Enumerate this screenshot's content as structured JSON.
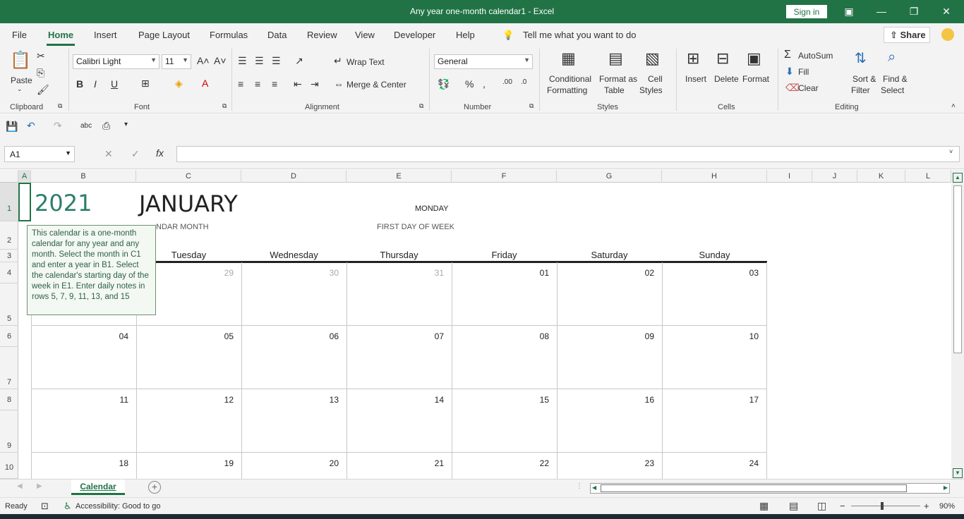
{
  "titlebar": {
    "title": "Any year one-month calendar1  -  Excel",
    "signin": "Sign in"
  },
  "menu": {
    "items": [
      "File",
      "Home",
      "Insert",
      "Page Layout",
      "Formulas",
      "Data",
      "Review",
      "View",
      "Developer",
      "Help"
    ],
    "active": "Home",
    "tell_me": "Tell me what you want to do",
    "share": "Share"
  },
  "ribbon": {
    "clipboard": {
      "paste": "Paste",
      "label": "Clipboard"
    },
    "font": {
      "name": "Calibri Light",
      "size": "11",
      "label": "Font",
      "bold": "B",
      "italic": "I",
      "underline": "U"
    },
    "alignment": {
      "wrap": "Wrap Text",
      "merge": "Merge & Center",
      "label": "Alignment"
    },
    "number": {
      "format": "General",
      "label": "Number"
    },
    "styles": {
      "conditional": [
        "Conditional",
        "Formatting"
      ],
      "format_table": [
        "Format as",
        "Table"
      ],
      "cell_styles": [
        "Cell",
        "Styles"
      ],
      "label": "Styles"
    },
    "cells": {
      "insert": "Insert",
      "delete": "Delete",
      "format": "Format",
      "label": "Cells"
    },
    "editing": {
      "autosum": "AutoSum",
      "fill": "Fill",
      "clear": "Clear",
      "sort": [
        "Sort &",
        "Filter"
      ],
      "find": [
        "Find &",
        "Select"
      ],
      "label": "Editing"
    }
  },
  "formula_bar": {
    "name_box": "A1",
    "fx": "fx",
    "value": ""
  },
  "columns": [
    "A",
    "B",
    "C",
    "D",
    "E",
    "F",
    "G",
    "H",
    "I",
    "J",
    "K",
    "L"
  ],
  "rows": [
    "1",
    "2",
    "3",
    "4",
    "5",
    "6",
    "7",
    "8",
    "9",
    "10"
  ],
  "calendar": {
    "year": "2021",
    "month": "JANUARY",
    "month_label": "NDAR MONTH",
    "first_day": "MONDAY",
    "first_day_label": "FIRST DAY OF WEEK",
    "weekdays": [
      "Tuesday",
      "Wednesday",
      "Thursday",
      "Friday",
      "Saturday",
      "Sunday"
    ],
    "weeks": [
      [
        "",
        "29",
        "30",
        "31",
        "01",
        "02",
        "03"
      ],
      [
        "04",
        "05",
        "06",
        "07",
        "08",
        "09",
        "10"
      ],
      [
        "11",
        "12",
        "13",
        "14",
        "15",
        "16",
        "17"
      ],
      [
        "18",
        "19",
        "20",
        "21",
        "22",
        "23",
        "24"
      ]
    ],
    "muted_days": [
      "29",
      "30",
      "31"
    ]
  },
  "tooltip": "This calendar is a one-month calendar for any year and any month. Select the month in C1 and enter a year in B1. Select the calendar's starting day of the week in E1. Enter daily notes in rows 5, 7, 9, 11, 13, and 15",
  "sheet_tab": "Calendar",
  "status": {
    "ready": "Ready",
    "accessibility": "Accessibility: Good to go",
    "zoom": "90%"
  },
  "colors": {
    "accent": "#217346",
    "year": "#2e7d6b"
  }
}
